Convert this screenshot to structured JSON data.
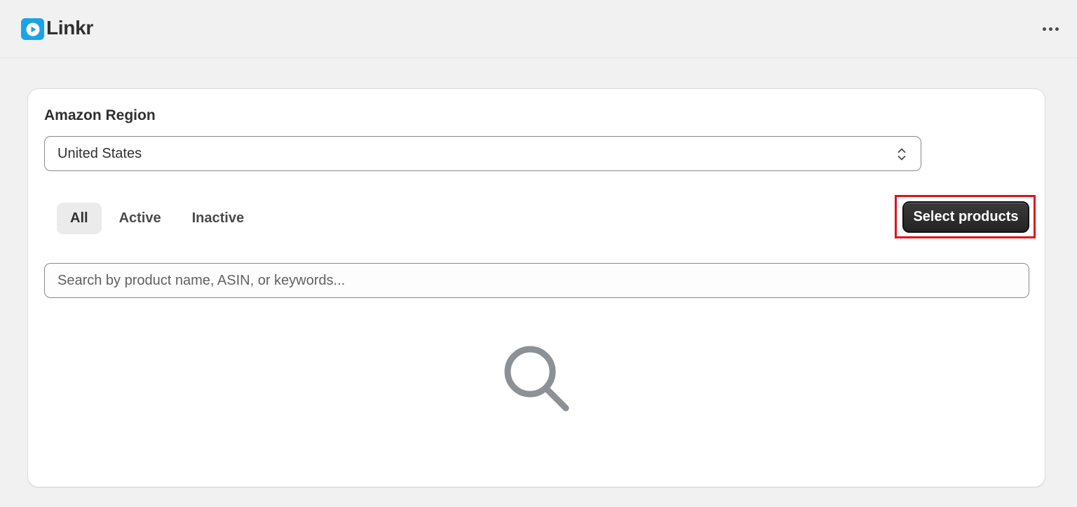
{
  "app": {
    "title": "Linkr",
    "logo_icon": "play-icon",
    "brand_color": "#1aa3e8",
    "more_icon": "more-horizontal-icon"
  },
  "region": {
    "label": "Amazon Region",
    "selected": "United States"
  },
  "tabs": [
    {
      "label": "All",
      "active": true
    },
    {
      "label": "Active",
      "active": false
    },
    {
      "label": "Inactive",
      "active": false
    }
  ],
  "actions": {
    "select_products_label": "Select products",
    "highlight_color": "#e0121b"
  },
  "search": {
    "placeholder": "Search by product name, ASIN, or keywords..."
  },
  "empty_state": {
    "icon": "search-icon"
  }
}
